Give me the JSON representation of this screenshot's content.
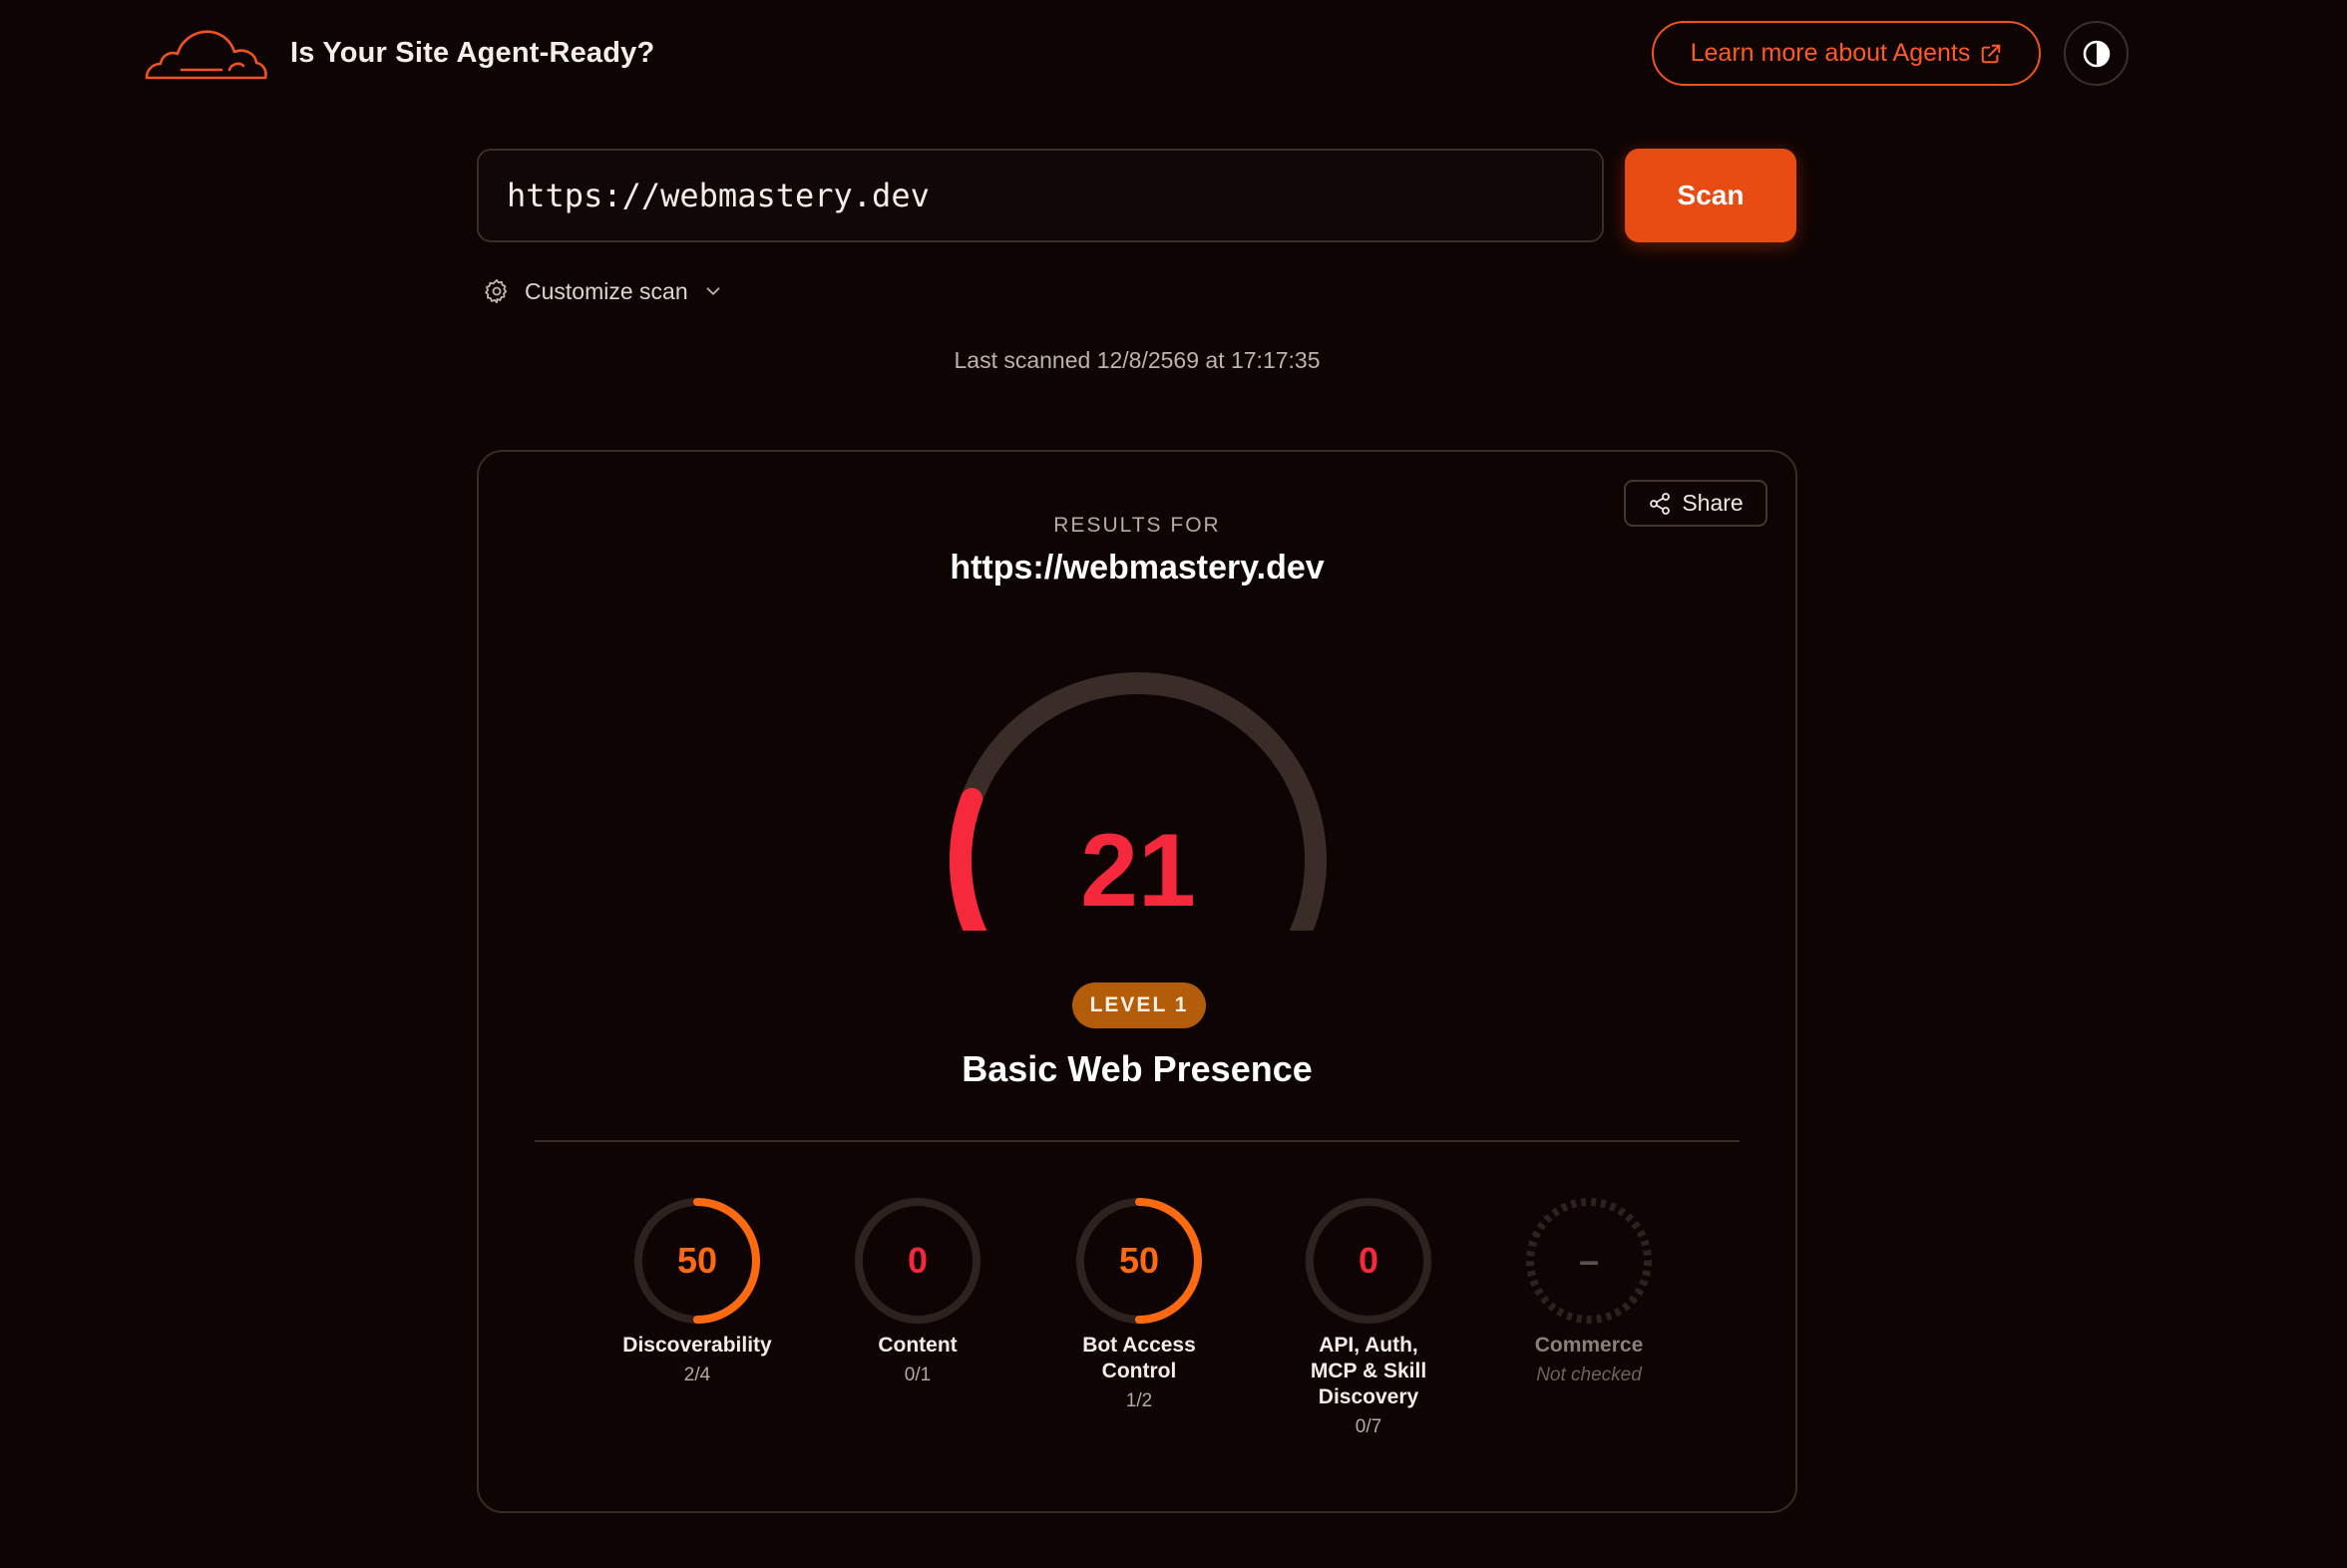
{
  "header": {
    "title": "Is Your Site Agent-Ready?",
    "learn_more_label": "Learn more about Agents",
    "icons": {
      "logo": "cloud-logo-icon",
      "external": "external-link-icon",
      "theme": "contrast-icon"
    }
  },
  "scan": {
    "url_value": "https://webmastery.dev",
    "button_label": "Scan",
    "customize_label": "Customize scan",
    "last_scanned": "Last scanned 12/8/2569 at 17:17:35"
  },
  "results": {
    "share_label": "Share",
    "results_for_label": "RESULTS FOR",
    "url": "https://webmastery.dev",
    "score": 21,
    "score_max": 100,
    "level_label": "LEVEL 1",
    "level_name": "Basic Web Presence",
    "categories": [
      {
        "score": "50",
        "percent": 50,
        "name": "Discoverability",
        "detail": "2/4"
      },
      {
        "score": "0",
        "percent": 0,
        "name": "Content",
        "detail": "0/1"
      },
      {
        "score": "50",
        "percent": 50,
        "name": "Bot Access Control",
        "detail": "1/2"
      },
      {
        "score": "0",
        "percent": 0,
        "name": "API, Auth, MCP & Skill Discovery",
        "detail": "0/7"
      },
      {
        "score": "–",
        "percent": null,
        "name": "Commerce",
        "detail": "Not checked"
      }
    ]
  },
  "colors": {
    "accent": "#e84c12",
    "score_red": "#f5283c",
    "score_orange": "#ff6a10",
    "level_badge": "#b35d0b"
  }
}
